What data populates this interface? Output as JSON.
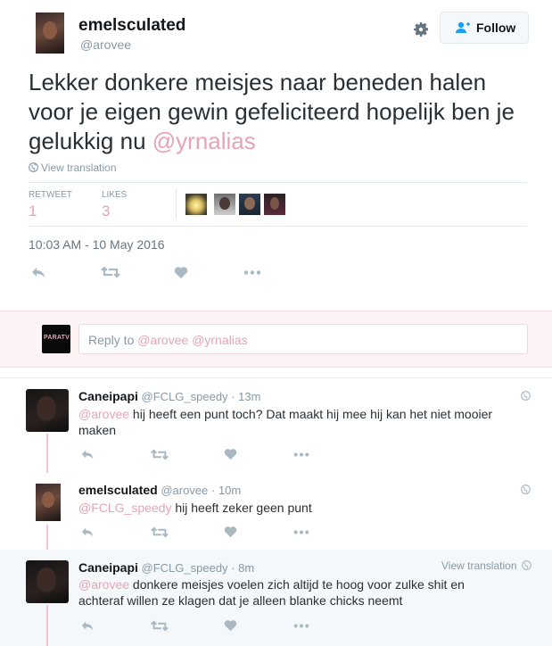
{
  "tweet": {
    "display_name": "emelsculated",
    "handle": "@arovee",
    "follow_label": "Follow",
    "text_main": "Lekker donkere meisjes naar beneden halen voor je eigen gewin gefeliciteerd hopelijk ben je gelukkig nu ",
    "text_mention": "@yrnalias",
    "view_translation": "View translation",
    "retweets_label": "RETWEET",
    "retweets_count": "1",
    "likes_label": "LIKES",
    "likes_count": "3",
    "timestamp": "10:03 AM - 10 May 2016"
  },
  "reply_box": {
    "avatar_text": "PARATV",
    "reply_prefix": "Reply to ",
    "reply_mentions": "@arovee @yrnalias"
  },
  "replies": [
    {
      "display_name": "Caneipapi",
      "handle": "@FCLG_speedy",
      "time": "· 13m",
      "mention": "@arovee",
      "text": " hij heeft een punt toch? Dat maakt hij mee hij kan het niet mooier maken"
    },
    {
      "display_name": "emelsculated",
      "handle": "@arovee",
      "time": "· 10m",
      "mention": "@FCLG_speedy",
      "text": " hij heeft zeker geen punt"
    },
    {
      "display_name": "Caneipapi",
      "handle": "@FCLG_speedy",
      "time": "· 8m",
      "view_translation": "View translation",
      "mention": "@arovee",
      "text": " donkere meisjes voelen zich altijd te hoog voor zulke shit en achteraf willen ze klagen dat je alleen blanke chicks neemt"
    }
  ],
  "icons": {
    "settings": "gear-icon",
    "follow": "add-user-icon",
    "globe": "globe-icon",
    "reply": "reply-icon",
    "retweet": "retweet-icon",
    "like": "heart-icon",
    "more": "more-icon"
  },
  "colors": {
    "link": "#e6a4b4",
    "muted": "#8899a6",
    "action": "#aab8c2",
    "reply_bar_bg": "#fdf3f5"
  }
}
